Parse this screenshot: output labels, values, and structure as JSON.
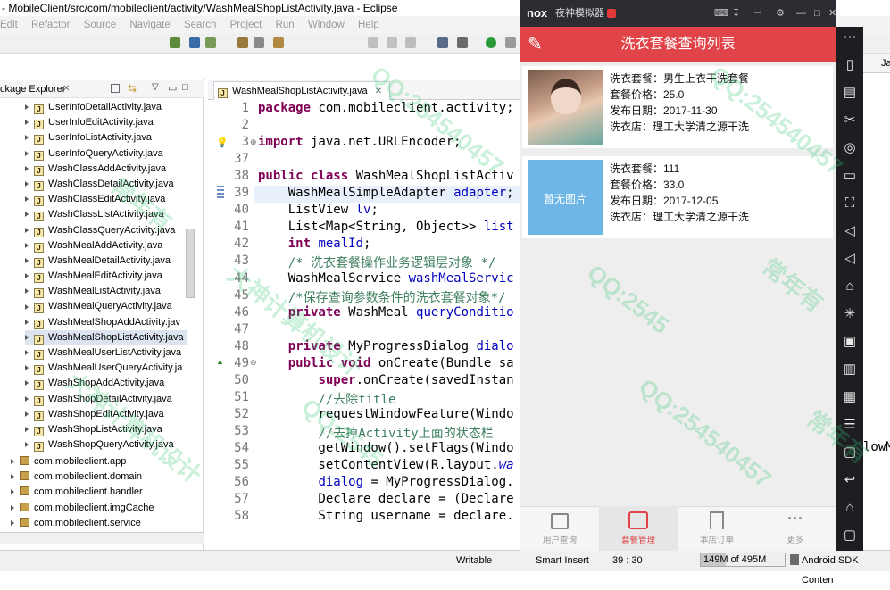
{
  "window": {
    "title": "- MobileClient/src/com/mobileclient/activity/WashMealShopListActivity.java - Eclipse",
    "menu": [
      "Edit",
      "Refactor",
      "Source",
      "Navigate",
      "Search",
      "Project",
      "Run",
      "Window",
      "Help"
    ]
  },
  "package_explorer": {
    "title": "ckage Explorer",
    "files": [
      "UserInfoDetailActivity.java",
      "UserInfoEditActivity.java",
      "UserInfoListActivity.java",
      "UserInfoQueryActivity.java",
      "WashClassAddActivity.java",
      "WashClassDetailActivity.java",
      "WashClassEditActivity.java",
      "WashClassListActivity.java",
      "WashClassQueryActivity.java",
      "WashMealAddActivity.java",
      "WashMealDetailActivity.java",
      "WashMealEditActivity.java",
      "WashMealListActivity.java",
      "WashMealQueryActivity.java",
      "WashMealShopAddActivity.jav",
      "WashMealShopListActivity.java",
      "WashMealUserListActivity.java",
      "WashMealUserQueryActivity.ja",
      "WashShopAddActivity.java",
      "WashShopDetailActivity.java",
      "WashShopEditActivity.java",
      "WashShopListActivity.java",
      "WashShopQueryActivity.java"
    ],
    "selected_index": 15,
    "packages": [
      "com.mobileclient.app",
      "com.mobileclient.domain",
      "com.mobileclient.handler",
      "com.mobileclient.imgCache",
      "com.mobileclient.service"
    ]
  },
  "editor": {
    "tab_label": "WashMealShopListActivity.java",
    "lines": [
      {
        "n": "1",
        "html": "<span class='kw'>package</span> com.mobileclient.activity;"
      },
      {
        "n": "2",
        "html": ""
      },
      {
        "n": "3",
        "html": "<span class='kw'>import</span> java.net.URLEncoder;"
      },
      {
        "n": "37",
        "html": ""
      },
      {
        "n": "38",
        "html": "<span class='kw'>public class</span> WashMealShopListActiv"
      },
      {
        "n": "39",
        "html": "    WashMealSimpleAdapter <span class='fd'>adapter</span>;",
        "hl": true
      },
      {
        "n": "40",
        "html": "    ListView <span class='fd'>lv</span>;"
      },
      {
        "n": "41",
        "html": "    List&lt;Map&lt;String, Object&gt;&gt; <span class='fd'>list</span>"
      },
      {
        "n": "42",
        "html": "    <span class='kw'>int</span> <span class='fd'>mealId</span>;"
      },
      {
        "n": "43",
        "html": "    <span class='cm'>/* 洗衣套餐操作业务逻辑层对象 */</span>"
      },
      {
        "n": "44",
        "html": "    WashMealService <span class='fd'>washMealServic</span>"
      },
      {
        "n": "45",
        "html": "    <span class='cm'>/*保存查询参数条件的洗衣套餐对象*/</span>"
      },
      {
        "n": "46",
        "html": "    <span class='kw'>private</span> WashMeal <span class='fd'>queryConditio</span>"
      },
      {
        "n": "47",
        "html": ""
      },
      {
        "n": "48",
        "html": "    <span class='kw'>private</span> MyProgressDialog <span class='fd'>dialo</span>"
      },
      {
        "n": "49",
        "html": "    <span class='kw'>public void</span> onCreate(Bundle sa"
      },
      {
        "n": "50",
        "html": "        <span class='kw'>super</span>.onCreate(savedInstan"
      },
      {
        "n": "51",
        "html": "        <span class='cm'>//去除title</span>"
      },
      {
        "n": "52",
        "html": "        requestWindowFeature(Windo"
      },
      {
        "n": "53",
        "html": "        <span class='cm'>//去掉Activity上面的状态栏</span>"
      },
      {
        "n": "54",
        "html": "        getWindow().setFlags(Windo"
      },
      {
        "n": "55",
        "html": "        setContentView(R.layout.<span class='it'>wa</span>"
      },
      {
        "n": "56",
        "html": "        <span class='fd'>dialog</span> = MyProgressDialog."
      },
      {
        "n": "57",
        "html": "        Declare declare = (Declare"
      },
      {
        "n": "58",
        "html": "        String username = declare."
      }
    ]
  },
  "status": {
    "writable": "Writable",
    "insert_mode": "Smart Insert",
    "position": "39 : 30",
    "memory": "149M of 495M",
    "memory_fraction": 0.3,
    "sdk": "Android SDK Conten"
  },
  "right_peek": {
    "tab": "Jav",
    "code": "lowM"
  },
  "emulator": {
    "title": "夜神模拟器",
    "logo": "nox",
    "app_title": "洗衣套餐查询列表",
    "items": [
      {
        "name": "洗衣套餐：男生上衣干洗套餐",
        "price": "套餐价格：25.0",
        "date": "发布日期：2017-11-30",
        "shop": "洗衣店：理工大学清之源干洗",
        "has_photo": true
      },
      {
        "name": "洗衣套餐：111",
        "price": "套餐价格：33.0",
        "date": "发布日期：2017-12-05",
        "shop": "洗衣店：理工大学清之源干洗",
        "no_photo_text": "暂无图片"
      }
    ],
    "nav": [
      "用户查询",
      "套餐管理",
      "本店订单",
      "更多"
    ],
    "active_nav": 1,
    "accent": "#e04448"
  },
  "watermarks": [
    "QQ:254540457",
    "常年有",
    "大神计算机设计",
    "QQ:2545"
  ]
}
